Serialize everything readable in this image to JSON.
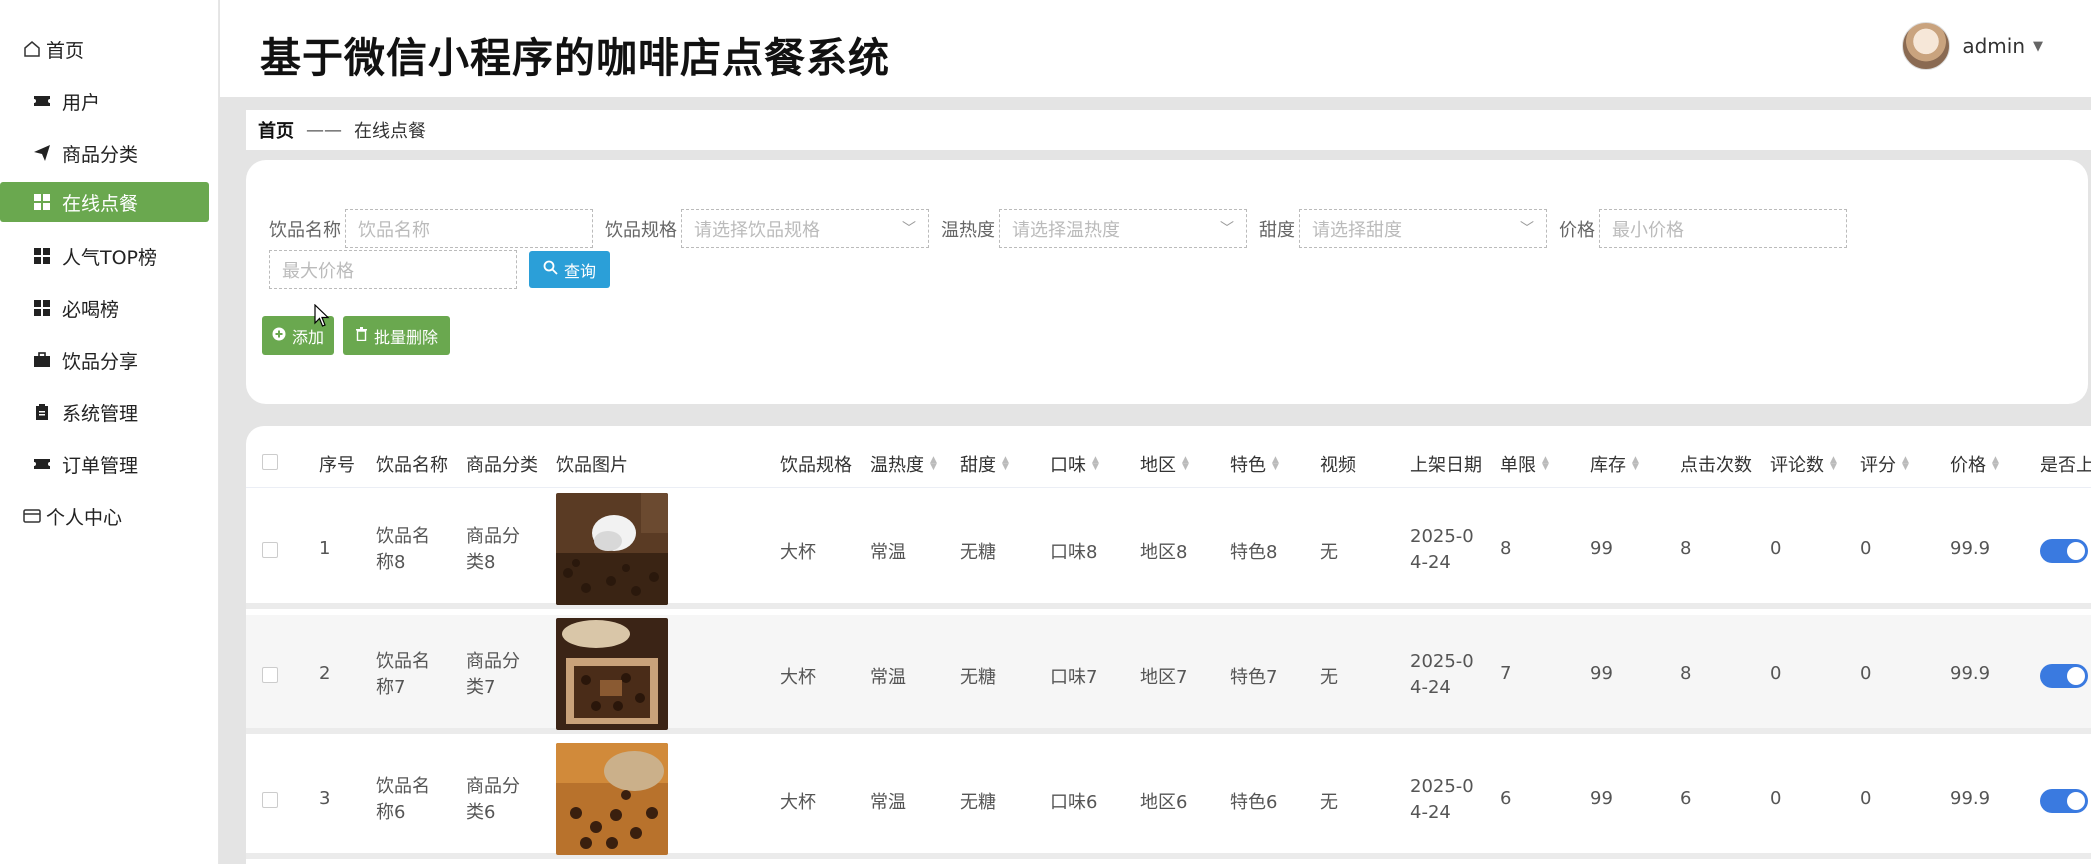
{
  "app": {
    "title": "基于微信小程序的咖啡店点餐系统"
  },
  "user": {
    "name": "admin"
  },
  "sidebar": {
    "items": [
      {
        "label": "首页",
        "icon": "home-icon"
      },
      {
        "label": "用户",
        "icon": "ticket-icon"
      },
      {
        "label": "商品分类",
        "icon": "send-icon"
      },
      {
        "label": "在线点餐",
        "icon": "grid-icon",
        "active": true
      },
      {
        "label": "人气TOP榜",
        "icon": "grid-icon"
      },
      {
        "label": "必喝榜",
        "icon": "grid-icon"
      },
      {
        "label": "饮品分享",
        "icon": "briefcase-icon"
      },
      {
        "label": "系统管理",
        "icon": "clipboard-icon"
      },
      {
        "label": "订单管理",
        "icon": "ticket-icon"
      },
      {
        "label": "个人中心",
        "icon": "wallet-icon"
      }
    ]
  },
  "breadcrumb": {
    "home": "首页",
    "separator": "——",
    "current": "在线点餐"
  },
  "search": {
    "name_label": "饮品名称",
    "name_placeholder": "饮品名称",
    "spec_label": "饮品规格",
    "spec_placeholder": "请选择饮品规格",
    "temp_label": "温热度",
    "temp_placeholder": "请选择温热度",
    "sweet_label": "甜度",
    "sweet_placeholder": "请选择甜度",
    "price_label": "价格",
    "min_placeholder": "最小价格",
    "max_placeholder": "最大价格",
    "query_button": "查询"
  },
  "actions": {
    "add_button": "添加",
    "batch_delete_button": "批量删除"
  },
  "table": {
    "columns": [
      "序号",
      "饮品名称",
      "商品分类",
      "饮品图片",
      "饮品规格",
      "温热度",
      "甜度",
      "口味",
      "地区",
      "特色",
      "视频",
      "上架日期",
      "单限",
      "库存",
      "点击次数",
      "评论数",
      "评分",
      "价格",
      "是否上"
    ],
    "rows": [
      {
        "index": "1",
        "name": "饮品名称8",
        "category": "商品分类8",
        "spec": "大杯",
        "temp": "常温",
        "sweet": "无糖",
        "taste": "口味8",
        "region": "地区8",
        "feature": "特色8",
        "video": "无",
        "date": "2025-04-24",
        "limit": "8",
        "stock": "99",
        "clicks": "8",
        "comments": "0",
        "rating": "0",
        "price": "99.9",
        "on_shelf": true
      },
      {
        "index": "2",
        "name": "饮品名称7",
        "category": "商品分类7",
        "spec": "大杯",
        "temp": "常温",
        "sweet": "无糖",
        "taste": "口味7",
        "region": "地区7",
        "feature": "特色7",
        "video": "无",
        "date": "2025-04-24",
        "limit": "7",
        "stock": "99",
        "clicks": "8",
        "comments": "0",
        "rating": "0",
        "price": "99.9",
        "on_shelf": true
      },
      {
        "index": "3",
        "name": "饮品名称6",
        "category": "商品分类6",
        "spec": "大杯",
        "temp": "常温",
        "sweet": "无糖",
        "taste": "口味6",
        "region": "地区6",
        "feature": "特色6",
        "video": "无",
        "date": "2025-04-24",
        "limit": "6",
        "stock": "99",
        "clicks": "6",
        "comments": "0",
        "rating": "0",
        "price": "99.9",
        "on_shelf": true
      }
    ]
  },
  "colors": {
    "accent_green": "#6aa84f",
    "query_blue": "#2b9fd8",
    "toggle_blue": "#3a7ae0"
  }
}
